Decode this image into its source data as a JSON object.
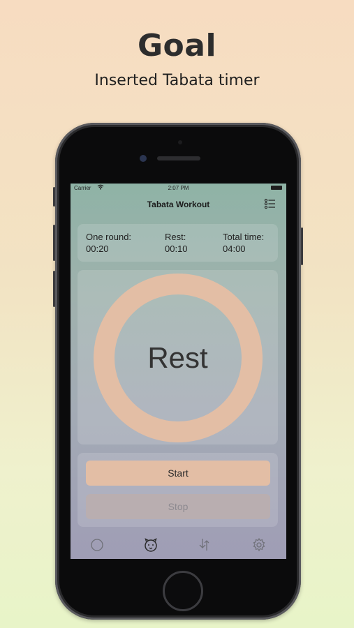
{
  "promo": {
    "headline": "Goal",
    "subline": "Inserted Tabata timer"
  },
  "status_bar": {
    "carrier": "Carrier",
    "time": "2:07 PM"
  },
  "nav": {
    "title": "Tabata Workout",
    "menu_icon": "list-icon"
  },
  "info": {
    "round_label": "One round:",
    "round_value": "00:20",
    "rest_label": "Rest:",
    "rest_value": "00:10",
    "total_label": "Total time:",
    "total_value": "04:00"
  },
  "timer": {
    "phase": "Rest",
    "ring_color": "#e3bea5"
  },
  "controls": {
    "start_label": "Start",
    "stop_label": "Stop"
  },
  "tabbar": {
    "tabs": [
      "circle-icon",
      "tiger-icon",
      "split-arrows-icon",
      "gear-icon"
    ],
    "active_tab": "tiger-icon"
  },
  "colors": {
    "start_button": "#e3bea5",
    "stop_button": "#b9aeb0"
  }
}
